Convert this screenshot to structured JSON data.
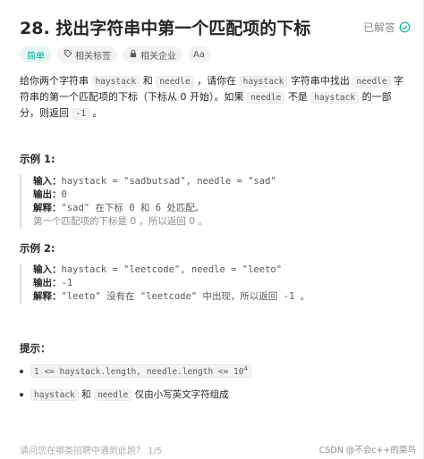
{
  "problem": {
    "title": "28. 找出字符串中第一个匹配项的下标",
    "status": "已解答",
    "tags": {
      "difficulty": "简单",
      "related_tags": "相关标签",
      "related_companies": "相关企业",
      "font_size": "Aa"
    }
  },
  "description": {
    "p1": "给你两个字符串 ",
    "code_haystack": "haystack",
    "p2": " 和 ",
    "code_needle": "needle",
    "p3": " ，请你在 ",
    "code_haystack2": "haystack",
    "p4": " 字符串中找出 ",
    "code_needle2": "needle",
    "p5": " 字符串的第一个匹配项的下标（下标从 0 开始）。如果 ",
    "code_needle3": "needle",
    "p6": " 不是 ",
    "code_haystack3": "haystack",
    "p7": " 的一部分，则返回 ",
    "code_neg1": "-1",
    "p8": " 。"
  },
  "examples": [
    {
      "heading": "示例 1:",
      "input_label": "输入：",
      "input_value": "haystack = \"sadbutsad\", needle = \"sad\"",
      "output_label": "输出：",
      "output_value": "0",
      "explain_label": "解释：",
      "explain_value": "\"sad\" 在下标 0 和 6 处匹配。",
      "explain_extra": "第一个匹配项的下标是 0 ，所以返回 0 。"
    },
    {
      "heading": "示例 2:",
      "input_label": "输入：",
      "input_value": "haystack = \"leetcode\", needle = \"leeto\"",
      "output_label": "输出：",
      "output_value": "-1",
      "explain_label": "解释：",
      "explain_value": "\"leeto\" 没有在 \"leetcode\" 中出现，所以返回 -1 。"
    }
  ],
  "tips": {
    "heading": "提示：",
    "item1_code": "1 <= haystack.length, needle.length <= 10",
    "item1_sup": "4",
    "item2_code_a": "haystack",
    "item2_text_a": " 和 ",
    "item2_code_b": "needle",
    "item2_text_b": " 仅由小写英文字符组成"
  },
  "footer": {
    "faded_text": "请问您在哪类招聘中遇到此题？ 1/5",
    "watermark": "CSDN @不会c++的菜鸟"
  },
  "colors": {
    "accent": "#00af9b",
    "text": "#262626",
    "muted": "#8c8c8c"
  },
  "icons": [
    "check-circle-icon",
    "tag-icon",
    "lock-icon"
  ]
}
